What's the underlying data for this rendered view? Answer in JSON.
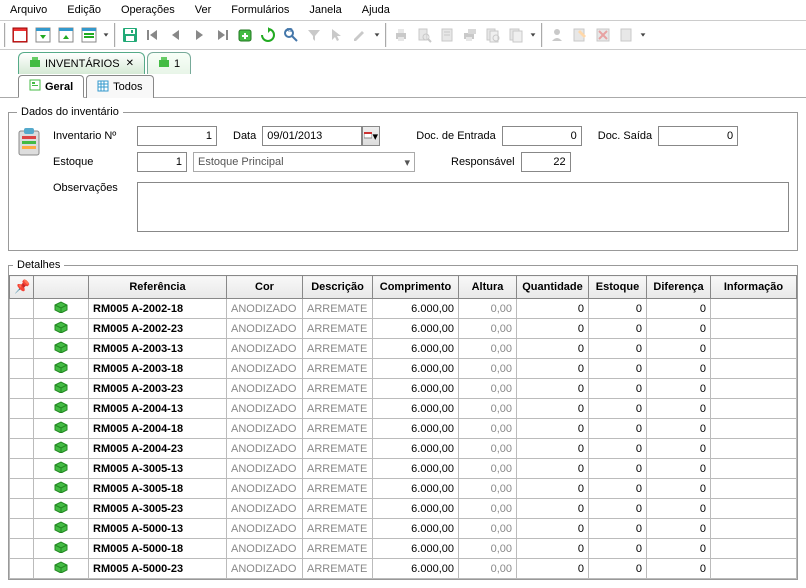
{
  "menu": [
    "Arquivo",
    "Edição",
    "Operações",
    "Ver",
    "Formulários",
    "Janela",
    "Ajuda"
  ],
  "mainTabs": [
    {
      "label": "INVENTÁRIOS",
      "active": true
    },
    {
      "label": "1",
      "active": false
    }
  ],
  "subTabs": [
    {
      "label": "Geral",
      "active": true
    },
    {
      "label": "Todos",
      "active": false
    }
  ],
  "form": {
    "legend": "Dados do inventário",
    "inv_lbl": "Inventario Nº",
    "inv_val": "1",
    "data_lbl": "Data",
    "data_val": "09/01/2013",
    "docin_lbl": "Doc. de Entrada",
    "docin_val": "0",
    "docout_lbl": "Doc. Saída",
    "docout_val": "0",
    "est_lbl": "Estoque",
    "est_num": "1",
    "est_name": "Estoque Principal",
    "resp_lbl": "Responsável",
    "resp_val": "22",
    "obs_lbl": "Observações",
    "obs_val": ""
  },
  "details": {
    "legend": "Detalhes",
    "headers": [
      "",
      "",
      "Referência",
      "Cor",
      "Descrição",
      "Comprimento",
      "Altura",
      "Quantidade",
      "Estoque",
      "Diferença",
      "Informação"
    ],
    "rows": [
      {
        "ref": "RM005 A-2002-18",
        "cor": "ANODIZADO",
        "desc": "ARREMATE",
        "comp": "6.000,00",
        "alt": "0,00",
        "qtd": "0",
        "est": "0",
        "dif": "0",
        "info": ""
      },
      {
        "ref": "RM005 A-2002-23",
        "cor": "ANODIZADO",
        "desc": "ARREMATE",
        "comp": "6.000,00",
        "alt": "0,00",
        "qtd": "0",
        "est": "0",
        "dif": "0",
        "info": ""
      },
      {
        "ref": "RM005 A-2003-13",
        "cor": "ANODIZADO",
        "desc": "ARREMATE",
        "comp": "6.000,00",
        "alt": "0,00",
        "qtd": "0",
        "est": "0",
        "dif": "0",
        "info": ""
      },
      {
        "ref": "RM005 A-2003-18",
        "cor": "ANODIZADO",
        "desc": "ARREMATE",
        "comp": "6.000,00",
        "alt": "0,00",
        "qtd": "0",
        "est": "0",
        "dif": "0",
        "info": ""
      },
      {
        "ref": "RM005 A-2003-23",
        "cor": "ANODIZADO",
        "desc": "ARREMATE",
        "comp": "6.000,00",
        "alt": "0,00",
        "qtd": "0",
        "est": "0",
        "dif": "0",
        "info": ""
      },
      {
        "ref": "RM005 A-2004-13",
        "cor": "ANODIZADO",
        "desc": "ARREMATE",
        "comp": "6.000,00",
        "alt": "0,00",
        "qtd": "0",
        "est": "0",
        "dif": "0",
        "info": ""
      },
      {
        "ref": "RM005 A-2004-18",
        "cor": "ANODIZADO",
        "desc": "ARREMATE",
        "comp": "6.000,00",
        "alt": "0,00",
        "qtd": "0",
        "est": "0",
        "dif": "0",
        "info": ""
      },
      {
        "ref": "RM005 A-2004-23",
        "cor": "ANODIZADO",
        "desc": "ARREMATE",
        "comp": "6.000,00",
        "alt": "0,00",
        "qtd": "0",
        "est": "0",
        "dif": "0",
        "info": ""
      },
      {
        "ref": "RM005 A-3005-13",
        "cor": "ANODIZADO",
        "desc": "ARREMATE",
        "comp": "6.000,00",
        "alt": "0,00",
        "qtd": "0",
        "est": "0",
        "dif": "0",
        "info": ""
      },
      {
        "ref": "RM005 A-3005-18",
        "cor": "ANODIZADO",
        "desc": "ARREMATE",
        "comp": "6.000,00",
        "alt": "0,00",
        "qtd": "0",
        "est": "0",
        "dif": "0",
        "info": ""
      },
      {
        "ref": "RM005 A-3005-23",
        "cor": "ANODIZADO",
        "desc": "ARREMATE",
        "comp": "6.000,00",
        "alt": "0,00",
        "qtd": "0",
        "est": "0",
        "dif": "0",
        "info": ""
      },
      {
        "ref": "RM005 A-5000-13",
        "cor": "ANODIZADO",
        "desc": "ARREMATE",
        "comp": "6.000,00",
        "alt": "0,00",
        "qtd": "0",
        "est": "0",
        "dif": "0",
        "info": ""
      },
      {
        "ref": "RM005 A-5000-18",
        "cor": "ANODIZADO",
        "desc": "ARREMATE",
        "comp": "6.000,00",
        "alt": "0,00",
        "qtd": "0",
        "est": "0",
        "dif": "0",
        "info": ""
      },
      {
        "ref": "RM005 A-5000-23",
        "cor": "ANODIZADO",
        "desc": "ARREMATE",
        "comp": "6.000,00",
        "alt": "0,00",
        "qtd": "0",
        "est": "0",
        "dif": "0",
        "info": ""
      }
    ]
  }
}
